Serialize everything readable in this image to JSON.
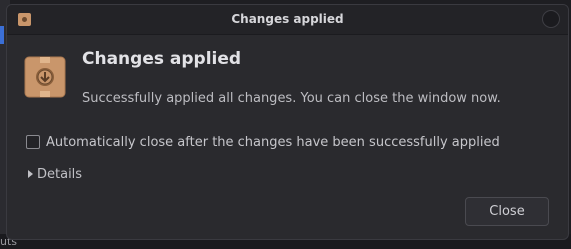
{
  "window": {
    "title": "Changes applied"
  },
  "dialog": {
    "heading": "Changes applied",
    "message": "Successfully applied all changes. You can close the window now.",
    "checkbox": {
      "label": "Automatically close after the changes have been successfully applied",
      "checked": false
    },
    "details_label": "Details",
    "close_label": "Close"
  },
  "background": {
    "partial_text": "uts"
  },
  "icons": {
    "app": "package-download-icon",
    "title": "package-icon",
    "window_close": "close-icon",
    "expander": "chevron-right-icon"
  },
  "colors": {
    "window_bg": "#2a2a2e",
    "icon_box": "#c9966b",
    "text": "#e2e2e6"
  }
}
